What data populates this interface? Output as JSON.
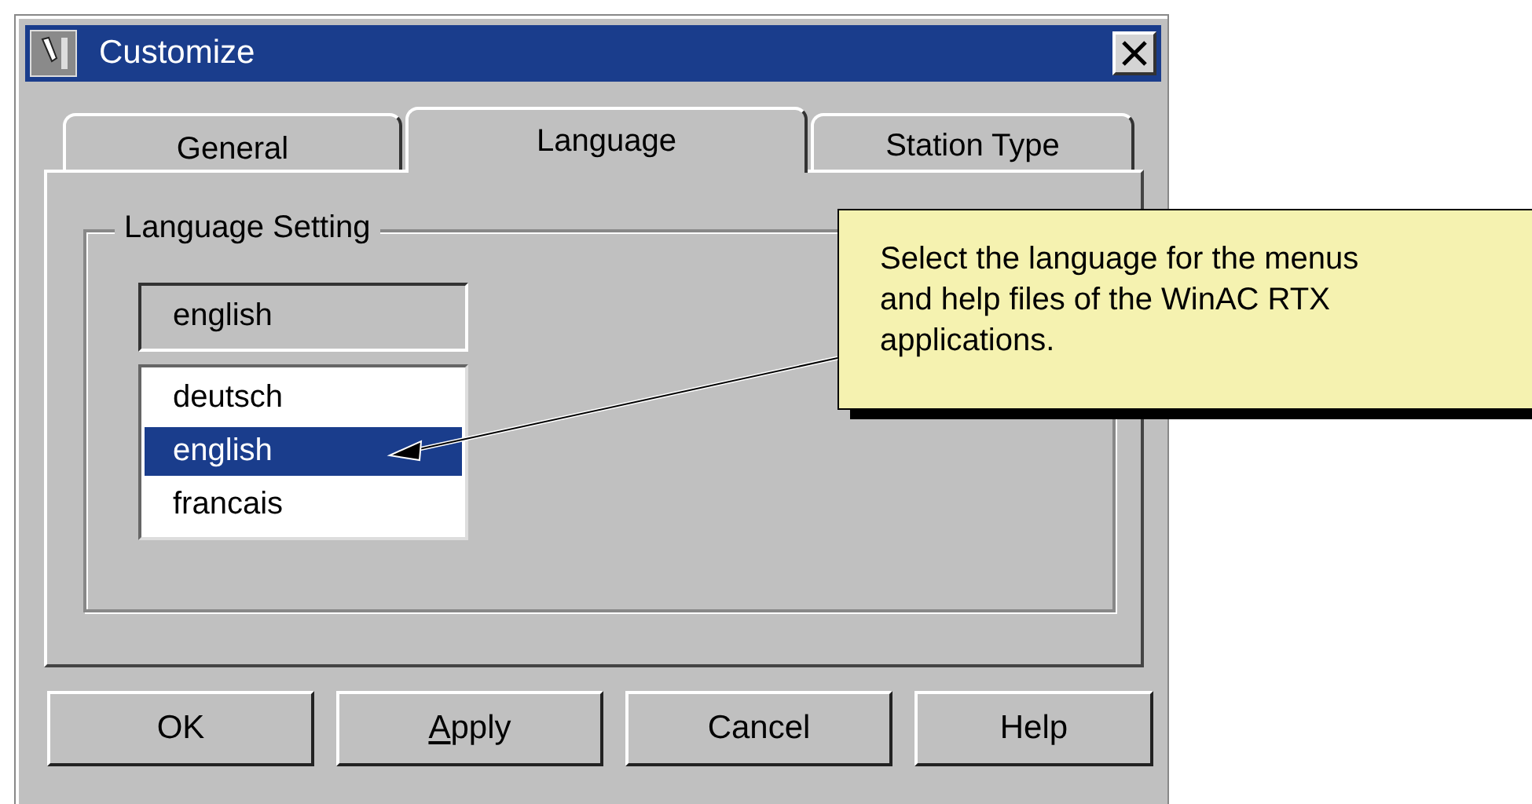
{
  "window": {
    "title": "Customize"
  },
  "tabs": [
    {
      "label": "General",
      "selected": false
    },
    {
      "label": "Language",
      "selected": true
    },
    {
      "label": "Station Type",
      "selected": false
    }
  ],
  "group": {
    "title": "Language Setting",
    "current_value": "english",
    "options": [
      {
        "label": "deutsch",
        "selected": false
      },
      {
        "label": "english",
        "selected": true
      },
      {
        "label": "francais",
        "selected": false
      }
    ]
  },
  "callout": {
    "text": "Select the language for the menus and help files of the WinAC RTX applications."
  },
  "buttons": [
    {
      "label": "OK"
    },
    {
      "label": "Apply",
      "access_key_underlined": true
    },
    {
      "label": "Cancel"
    },
    {
      "label": "Help"
    }
  ]
}
